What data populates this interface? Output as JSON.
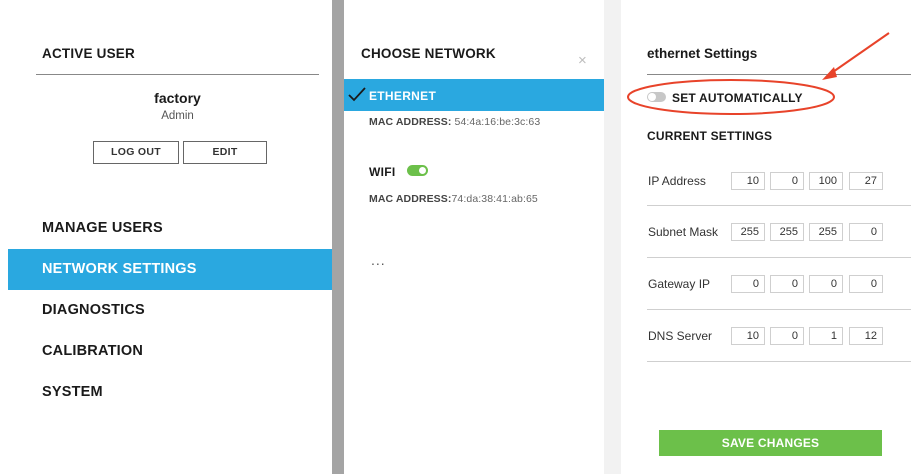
{
  "left": {
    "heading": "ACTIVE USER",
    "user_name": "factory",
    "user_role": "Admin",
    "logout_label": "LOG OUT",
    "edit_label": "EDIT",
    "nav": [
      {
        "label": "MANAGE USERS",
        "active": false
      },
      {
        "label": "NETWORK SETTINGS",
        "active": true
      },
      {
        "label": "DIAGNOSTICS",
        "active": false
      },
      {
        "label": "CALIBRATION",
        "active": false
      },
      {
        "label": "SYSTEM",
        "active": false
      }
    ]
  },
  "middle": {
    "heading": "CHOOSE NETWORK",
    "close_icon": "×",
    "mac_label": "MAC ADDRESS:",
    "networks": [
      {
        "name": "ETHERNET",
        "mac": "54:4a:16:be:3c:63",
        "selected": true,
        "icon": "check-icon"
      },
      {
        "name": "WIFI",
        "mac": "74:da:38:41:ab:65",
        "selected": false,
        "toggle_on": true
      }
    ],
    "more": "..."
  },
  "right": {
    "heading": "ethernet Settings",
    "set_auto_label": "SET AUTOMATICALLY",
    "set_auto_on": false,
    "current_heading": "CURRENT SETTINGS",
    "rows": [
      {
        "label": "IP Address",
        "values": [
          "10",
          "0",
          "100",
          "27"
        ]
      },
      {
        "label": "Subnet Mask",
        "values": [
          "255",
          "255",
          "255",
          "0"
        ]
      },
      {
        "label": "Gateway IP",
        "values": [
          "0",
          "0",
          "0",
          "0"
        ]
      },
      {
        "label": "DNS Server",
        "values": [
          "10",
          "0",
          "1",
          "12"
        ]
      }
    ],
    "save_label": "SAVE CHANGES"
  },
  "colors": {
    "accent_blue": "#2aa8e0",
    "accent_green": "#6cc04a",
    "annotation_red": "#e8432a",
    "divider_gray": "#a4a4a4"
  }
}
